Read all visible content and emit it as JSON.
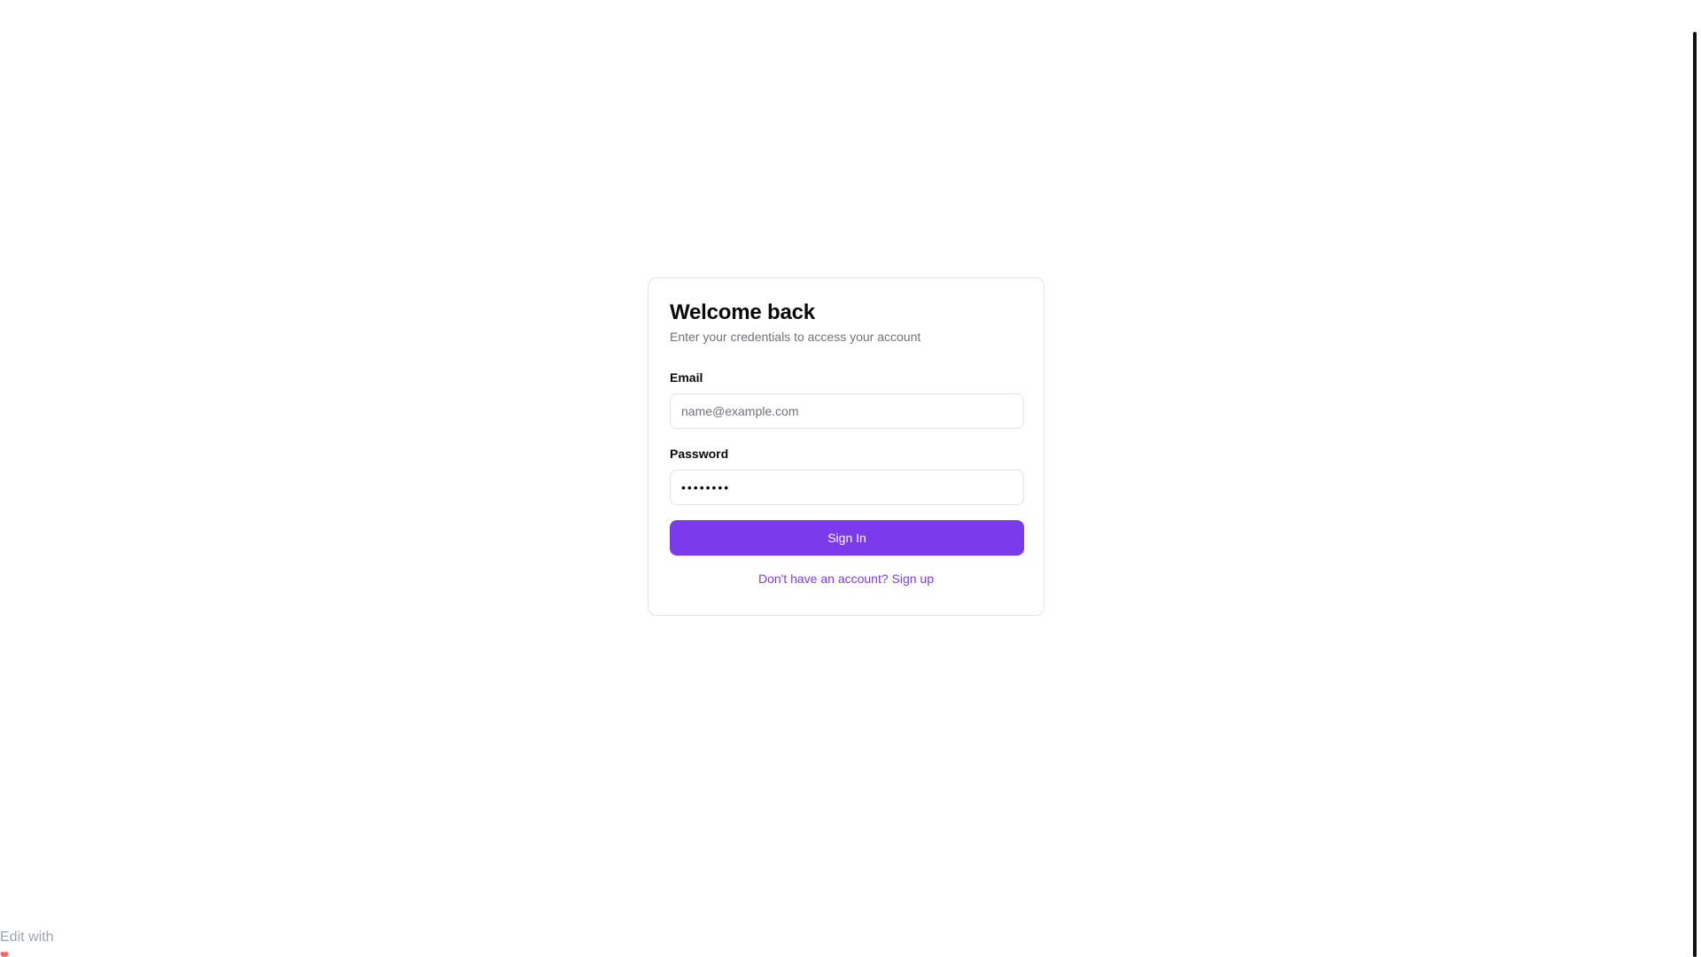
{
  "login_card": {
    "title": "Welcome back",
    "subtitle": "Enter your credentials to access your account",
    "email": {
      "label": "Email",
      "placeholder": "name@example.com",
      "value": ""
    },
    "password": {
      "label": "Password",
      "value": "••••••••"
    },
    "submit_label": "Sign In",
    "signup_link_text": "Don't have an account? Sign up"
  },
  "badge": {
    "text": "Edit with",
    "icon": "heart-logo-icon"
  },
  "colors": {
    "accent": "#7c3aed",
    "border": "#e4e4e7",
    "muted_text": "#71717a",
    "badge_text": "#9ca3af"
  }
}
